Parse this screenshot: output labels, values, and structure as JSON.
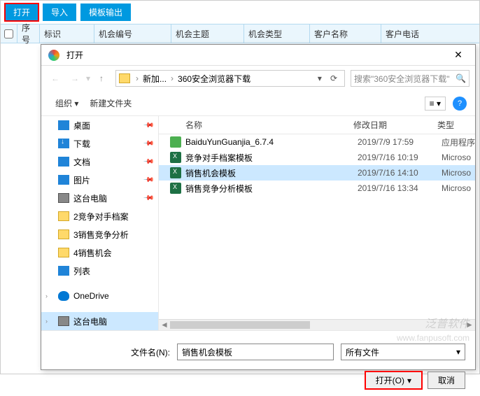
{
  "toolbar": {
    "open": "打开",
    "import": "导入",
    "template_export": "模板输出"
  },
  "table_headers": {
    "seq": "序号",
    "mark": "标识",
    "opp_num": "机会编号",
    "opp_subj": "机会主题",
    "opp_type": "机会类型",
    "cust_name": "客户名称",
    "cust_phone": "客户电话"
  },
  "dialog": {
    "title": "打开",
    "breadcrumb": {
      "seg1": "新加...",
      "seg2": "360安全浏览器下载"
    },
    "search_placeholder": "搜索\"360安全浏览器下载\"",
    "toolbar": {
      "organize": "组织",
      "new_folder": "新建文件夹"
    },
    "sidebar": {
      "desktop": "桌面",
      "download": "下载",
      "documents": "文档",
      "pictures": "图片",
      "this_pc": "这台电脑",
      "folder1": "2竞争对手档案",
      "folder2": "3销售竞争分析",
      "folder3": "4销售机会",
      "list": "列表",
      "onedrive": "OneDrive",
      "this_pc2": "这台电脑"
    },
    "filelist": {
      "headers": {
        "name": "名称",
        "date": "修改日期",
        "type": "类型"
      },
      "rows": [
        {
          "icon": "exe",
          "name": "BaiduYunGuanjia_6.7.4",
          "date": "2019/7/9 17:59",
          "type": "应用程序"
        },
        {
          "icon": "xls",
          "name": "竞争对手档案模板",
          "date": "2019/7/16 10:19",
          "type": "Microso"
        },
        {
          "icon": "xls",
          "name": "销售机会模板",
          "date": "2019/7/16 14:10",
          "type": "Microso",
          "selected": true
        },
        {
          "icon": "xls",
          "name": "销售竞争分析模板",
          "date": "2019/7/16 13:34",
          "type": "Microso"
        }
      ]
    },
    "filename_label": "文件名(N):",
    "filename_value": "销售机会模板",
    "filter": "所有文件",
    "open_btn": "打开(O)",
    "cancel_btn": "取消"
  },
  "watermark": {
    "line1": "泛普软件",
    "line2": "www.fanpusoft.com"
  }
}
